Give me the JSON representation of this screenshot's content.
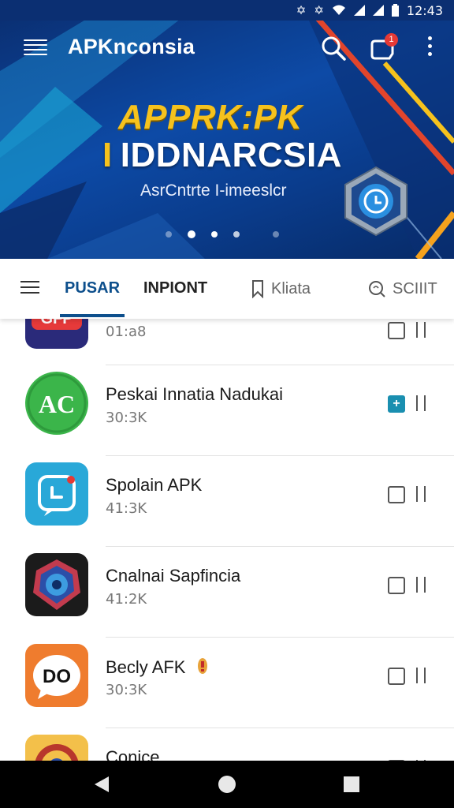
{
  "status_bar": {
    "time": "12:43",
    "icons": [
      "bluetooth-icon",
      "bluetooth-icon",
      "wifi-icon",
      "signal-icon",
      "signal-icon",
      "battery-icon"
    ]
  },
  "app_bar": {
    "title": "APKnconsia",
    "notification_count": "1",
    "icons": [
      "menu-icon",
      "search-icon",
      "notification-icon",
      "more-vert-icon"
    ]
  },
  "banner": {
    "line1": "APPRK:PK",
    "line2_accent": "I",
    "line2": "IDDNARCSIA",
    "subtitle": "AsrCntrte I-imeeslcr",
    "slides": 5,
    "active_slide": 1
  },
  "tabs": {
    "items": [
      {
        "label": "PUSAR",
        "active": true
      },
      {
        "label": "INPIONT",
        "active": false
      },
      {
        "label": "Kliata",
        "icon": "bookmark-icon",
        "active": false
      },
      {
        "label": "SCIIIT",
        "icon": "search-icon",
        "active": false
      }
    ]
  },
  "list": {
    "items": [
      {
        "name": "",
        "size": "01:a8",
        "icon": "gfp-app-icon",
        "icon_color": "#2a2a7a",
        "action_active": false
      },
      {
        "name": "Peskai Innatia Nadukai",
        "size": "30:3K",
        "icon": "ac-app-icon",
        "icon_color": "#3bb54a",
        "action_active": true
      },
      {
        "name": "Spolain APK",
        "size": "41:3K",
        "icon": "messenger-app-icon",
        "icon_color": "#29a8d8",
        "action_active": false
      },
      {
        "name": "Cnalnai Sapfincia",
        "size": "41:2K",
        "icon": "shield-app-icon",
        "icon_color": "#1b1b1b",
        "action_active": false
      },
      {
        "name": "Becly AFK",
        "size": "30:3K",
        "icon": "do-chat-app-icon",
        "icon_color": "#ef7c2e",
        "action_active": false,
        "badge": "warning-icon"
      },
      {
        "name": "Conice",
        "size": "",
        "icon": "emblem-app-icon",
        "icon_color": "#f3c04a",
        "action_active": false
      }
    ]
  },
  "nav_bar": {
    "buttons": [
      "back-icon",
      "home-icon",
      "recents-icon"
    ]
  },
  "colors": {
    "accent": "#0d4f8c",
    "banner_yellow": "#f6c21d",
    "badge_red": "#e53935",
    "action_teal": "#1a8fb0"
  }
}
